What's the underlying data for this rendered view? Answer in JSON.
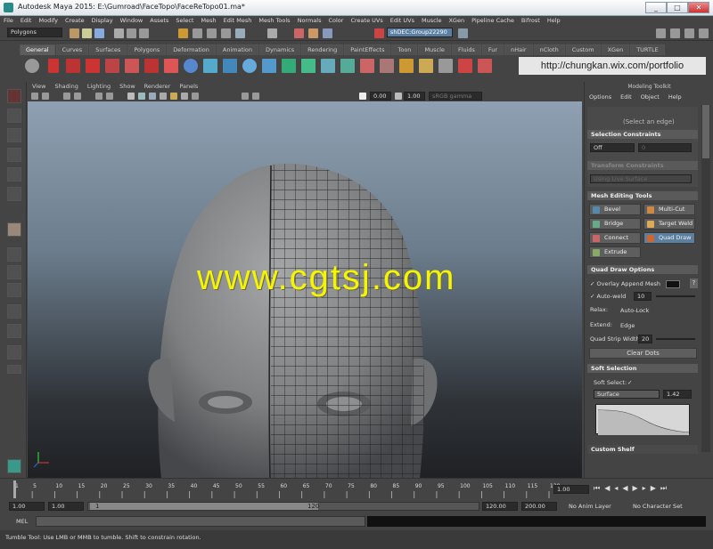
{
  "window": {
    "title": "Autodesk Maya 2015: E:\\Gumroad\\FaceTopo\\FaceReTopo01.ma*",
    "minimize": "_",
    "maximize": "□",
    "close": "✕"
  },
  "menus": [
    "File",
    "Edit",
    "Modify",
    "Create",
    "Display",
    "Window",
    "Assets",
    "Select",
    "Mesh",
    "Edit Mesh",
    "Mesh Tools",
    "Normals",
    "Color",
    "Create UVs",
    "Edit UVs",
    "Muscle",
    "XGen",
    "Pipeline Cache",
    "Bifrost",
    "Help"
  ],
  "status": {
    "menuset": "Polygons",
    "field": "shDEC:Group22290"
  },
  "shelf_tabs": [
    "General",
    "Curves",
    "Surfaces",
    "Polygons",
    "Deformation",
    "Animation",
    "Dynamics",
    "Rendering",
    "PaintEffects",
    "Toon",
    "Muscle",
    "Fluids",
    "Fur",
    "nHair",
    "nCloth",
    "Custom",
    "XGen",
    "TURTLE"
  ],
  "shelf_active": "General",
  "url_overlay": "http://chungkan.wix.com/portfolio",
  "viewport": {
    "menus": [
      "View",
      "Shading",
      "Lighting",
      "Show",
      "Renderer",
      "Panels"
    ],
    "exposure": "0.00",
    "gamma": "1.00",
    "color_space": "sRGB gamma"
  },
  "watermark": "www.cgtsj.com",
  "toolkit": {
    "title": "Modeling Toolkit",
    "menus": [
      "Options",
      "Edit",
      "Object",
      "Help"
    ],
    "select_hint": "(Select an edge)",
    "sel_constraints": "Selection Constraints",
    "sel_off": "Off",
    "sel_val": "0",
    "transform_constraints": "Transform Constraints",
    "live_surface": "Using Live Surface",
    "mesh_editing": "Mesh Editing Tools",
    "tools": [
      {
        "label": "Bevel",
        "color": "#58a"
      },
      {
        "label": "Multi-Cut",
        "color": "#c84"
      },
      {
        "label": "Bridge",
        "color": "#6a8"
      },
      {
        "label": "Target Weld",
        "color": "#da5"
      },
      {
        "label": "Connect",
        "color": "#c66"
      },
      {
        "label": "Quad Draw",
        "color": "#c63"
      },
      {
        "label": "Extrude",
        "color": "#8a6"
      }
    ],
    "quad_options": "Quad Draw Options",
    "overlay_label": "Overlay Append Mesh",
    "autoweld_label": "Auto-weld",
    "autoweld_val": "10",
    "relax_label": "Relax:",
    "relax_val": "Auto-Lock",
    "extend_label": "Extend:",
    "extend_val": "Edge",
    "strip_label": "Quad Strip Width:",
    "strip_val": "20",
    "clear_dots": "Clear Dots",
    "soft_selection": "Soft Selection",
    "soft_select_label": "Soft Select:",
    "falloff_mode": "Surface",
    "falloff_val": "1.42",
    "custom_shelf": "Custom Shelf",
    "help_btn": "?"
  },
  "timeline": {
    "ticks": [
      "1",
      "5",
      "10",
      "15",
      "20",
      "25",
      "30",
      "35",
      "40",
      "45",
      "50",
      "55",
      "60",
      "65",
      "70",
      "75",
      "80",
      "85",
      "90",
      "95",
      "100",
      "105",
      "110",
      "115",
      "120"
    ],
    "current": "1.00"
  },
  "range": {
    "start": "1.00",
    "range_start": "1.00",
    "slider_start": "1",
    "slider_end": "120",
    "range_end": "120.00",
    "end": "200.00",
    "anim_layer": "No Anim Layer",
    "char_set": "No Character Set"
  },
  "mel": {
    "label": "MEL"
  },
  "help_line": "Tumble Tool: Use LMB or MMB to tumble. Shift to constrain rotation."
}
